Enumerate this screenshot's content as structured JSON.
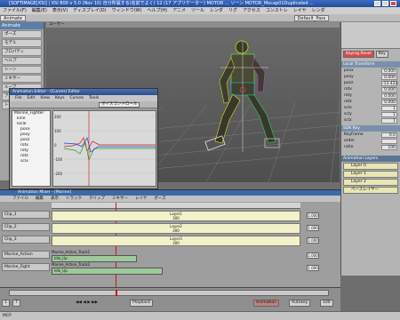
{
  "window": {
    "title": "[SOFTIMAGE|XSI] | XSI 800 v 5.0 (Nov 10) 自分所属する(名前でよく) 12 (17 アプリケーター) MOTOR ... ソーン MOTOR_Mocap01Duplicated ..."
  },
  "menubar": {
    "items": [
      "ファイル(F)",
      "編集(E)",
      "表示(V)",
      "ディスプレイ(D)",
      "ウィンドウ(W)",
      "ヘルプ(H)",
      "アニメ",
      "ツール",
      "レンダ",
      "リグ",
      "アクセス",
      "コンストレ",
      "レイヤ",
      "レンダ"
    ]
  },
  "toolbar": {
    "mode": "Animate",
    "selection": "Default_Pass"
  },
  "left_panel": {
    "header": "Animate",
    "items": [
      "ポーズ",
      "モデル",
      "プロパティ",
      "ヘルプ",
      "シーン",
      "ミキサー",
      "ループ",
      "アニメーション",
      "トランス"
    ]
  },
  "viewport": {
    "label": "ユーザー"
  },
  "right_panel": {
    "tabs": [
      "Keying Panel",
      "Key"
    ],
    "sections": [
      {
        "title": "Local Transform",
        "rows": [
          {
            "label": "posx",
            "value": "0.000"
          },
          {
            "label": "posy",
            "value": "0.000"
          },
          {
            "label": "posz",
            "value": "-13.422"
          },
          {
            "label": "rotx",
            "value": "0.000"
          },
          {
            "label": "roty",
            "value": "0.000"
          },
          {
            "label": "rotz",
            "value": "0.000"
          },
          {
            "label": "sclx",
            "value": "1"
          },
          {
            "label": "scly",
            "value": "1"
          },
          {
            "label": "sclz",
            "value": "1"
          }
        ]
      },
      {
        "title": "SDK Key",
        "rows": [
          {
            "label": "Keyframe",
            "value": "0.0"
          },
          {
            "label": "order",
            "value": ""
          },
          {
            "label": "ratio",
            "value": "100"
          }
        ]
      }
    ],
    "layer_panel_title": "Animation Layers",
    "layers": [
      "Layer 0",
      "Layer 1",
      "Layer 2",
      "ベースレイヤー"
    ]
  },
  "graph_editor": {
    "title": "Animation Editor - (Curves) Editor",
    "menu": [
      "File",
      "Edit",
      "View",
      "Keys",
      "Curves",
      "Tools"
    ],
    "field": "ボイスコントロール",
    "tree": [
      "Marine_Fighter",
      "kine",
      "local",
      "posx",
      "posy",
      "posz",
      "rotx",
      "roty",
      "rotz",
      "sclx"
    ],
    "y_ticks": [
      "200",
      "100",
      "0",
      "-100",
      "-200"
    ]
  },
  "animation_mixer": {
    "title": "Animation Mixer - [Marine]",
    "menu": [
      "ファイル",
      "編集",
      "表示",
      "トラック",
      "クリップ",
      "ミキサー",
      "レイヤ",
      "ポーズ"
    ],
    "tracks": [
      {
        "label": "Clip_1",
        "name": "Layer1",
        "sub": "300",
        "value": "1.000"
      },
      {
        "label": "Clip_2",
        "name": "Layer2",
        "sub": "300",
        "value": "1.000"
      },
      {
        "label": "Clip_3",
        "name": "Layer3",
        "sub": "300",
        "value": "1.000"
      },
      {
        "label": "Marine_Action",
        "name": "Marine_Action_Track1",
        "sub": "Idle_Up",
        "value": "1.000"
      },
      {
        "label": "Marine_Fight",
        "name": "Marine_Action_Track2",
        "sub": "Idle_Up",
        "value": "1.000"
      }
    ]
  },
  "playback": {
    "frame": "7",
    "start": "1",
    "end": "100",
    "playback_label": "Playback",
    "animation_label": "Animation",
    "mode": "Autokey"
  },
  "status": {
    "text": "MCP"
  }
}
